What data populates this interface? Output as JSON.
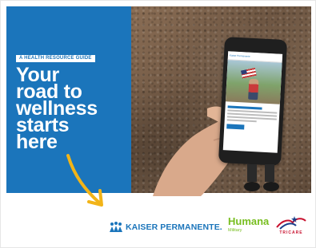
{
  "banner": {
    "badge": "A HEALTH RESOURCE GUIDE",
    "headline_lines": [
      "Your",
      "road to",
      "wellness",
      "starts",
      "here"
    ]
  },
  "phone": {
    "header_text": "Kaiser Permanente"
  },
  "logos": {
    "kaiser": "KAISER PERMANENTE.",
    "humana_word": "Humana",
    "humana_sub": "Military",
    "tricare": "TRICARE"
  },
  "colors": {
    "blue": "#1b75bb",
    "arrow": "#f2b418",
    "humana_green": "#78be20",
    "tricare_red": "#c8102e"
  }
}
